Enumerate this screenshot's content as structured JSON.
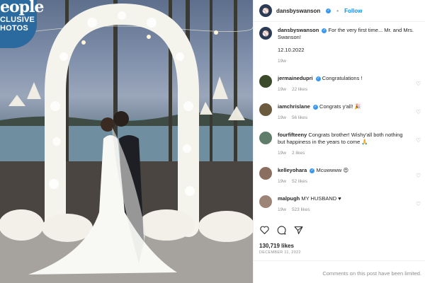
{
  "photo": {
    "overlay_brand": "eople",
    "overlay_tag_line1": "CLUSIVE",
    "overlay_tag_line2": "HOTOS"
  },
  "post": {
    "author": "dansbyswanson",
    "follow_label": "Follow",
    "separator": "•",
    "avatar_color": "#2b3a55",
    "caption": {
      "username": "dansbyswanson",
      "text": "For the very first time... Mr. and Mrs. Swanson!",
      "date_tag": "12.10.2022",
      "age": "19w"
    },
    "comments": [
      {
        "username": "jermainedupri",
        "text": "Congratulations !",
        "age": "19w",
        "likes": "22 likes",
        "avatar_color": "#3b4a2a"
      },
      {
        "username": "iamchrislane",
        "text": "Congrats y'all! 🎉",
        "age": "19w",
        "likes": "56 likes",
        "avatar_color": "#6b5a3e"
      },
      {
        "username": "fourfifteeny",
        "text": "Congrats brother! Wishy'all both nothing but happiness in the years to come 🙏",
        "age": "19w",
        "likes": "2 likes",
        "avatar_color": "#5f7d6a"
      },
      {
        "username": "kelleyohara",
        "text": "Mcuwwww 😍",
        "age": "19w",
        "likes": "52 likes",
        "avatar_color": "#8a6f60"
      },
      {
        "username": "malpugh",
        "text": "MY HUSBAND ♥",
        "age": "19w",
        "likes": "523 likes",
        "avatar_color": "#9c8476"
      }
    ],
    "likes_count": "130,719 likes",
    "date": "DECEMBER 11, 2022",
    "comments_limited": "Comments on this post have been limited."
  },
  "colors": {
    "accent": "#0095f6",
    "verified": "#3897f0",
    "muted": "#8e8e8e",
    "overlay": "#2a6a9e"
  }
}
